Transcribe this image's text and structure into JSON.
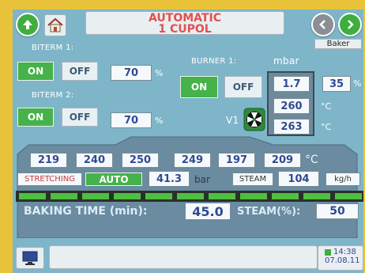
{
  "header": {
    "title_line1": "AUTOMATIC",
    "title_line2": "1 CUPOL",
    "user": "Baker"
  },
  "biterm1": {
    "label": "BITERM 1:",
    "on_label": "ON",
    "off_label": "OFF",
    "value": "70",
    "unit": "%"
  },
  "biterm2": {
    "label": "BITERM 2:",
    "on_label": "ON",
    "off_label": "OFF",
    "value": "70",
    "unit": "%"
  },
  "burner1": {
    "label": "BURNER 1:",
    "pressure_unit": "mbar",
    "on_label": "ON",
    "off_label": "OFF",
    "pressure": "1.7",
    "percent": "35",
    "percent_unit": "%",
    "temp_set": "260",
    "temp_actual": "263",
    "temp_unit": "°C",
    "valve_label": "V1"
  },
  "zones": {
    "temps": [
      "219",
      "240",
      "250",
      "249",
      "197",
      "209"
    ],
    "unit": "°C"
  },
  "conveyor": {
    "stretching_label": "STRETCHING",
    "mode_label": "AUTO",
    "pressure": "41.3",
    "pressure_unit": "bar",
    "steam_label": "STEAM",
    "steam_value": "104",
    "steam_unit": "kg/h"
  },
  "baking": {
    "time_label": "BAKING TIME (min):",
    "time_value": "45.0",
    "steam_pct_label": "STEAM(%):",
    "steam_pct_value": "50"
  },
  "clock": {
    "time": "14:38",
    "date": "07.08.11"
  },
  "colors": {
    "accent_green": "#3fae3f",
    "title_red": "#e05050",
    "value_blue": "#2f4a92",
    "panel_bg": "#7fb5c9"
  }
}
